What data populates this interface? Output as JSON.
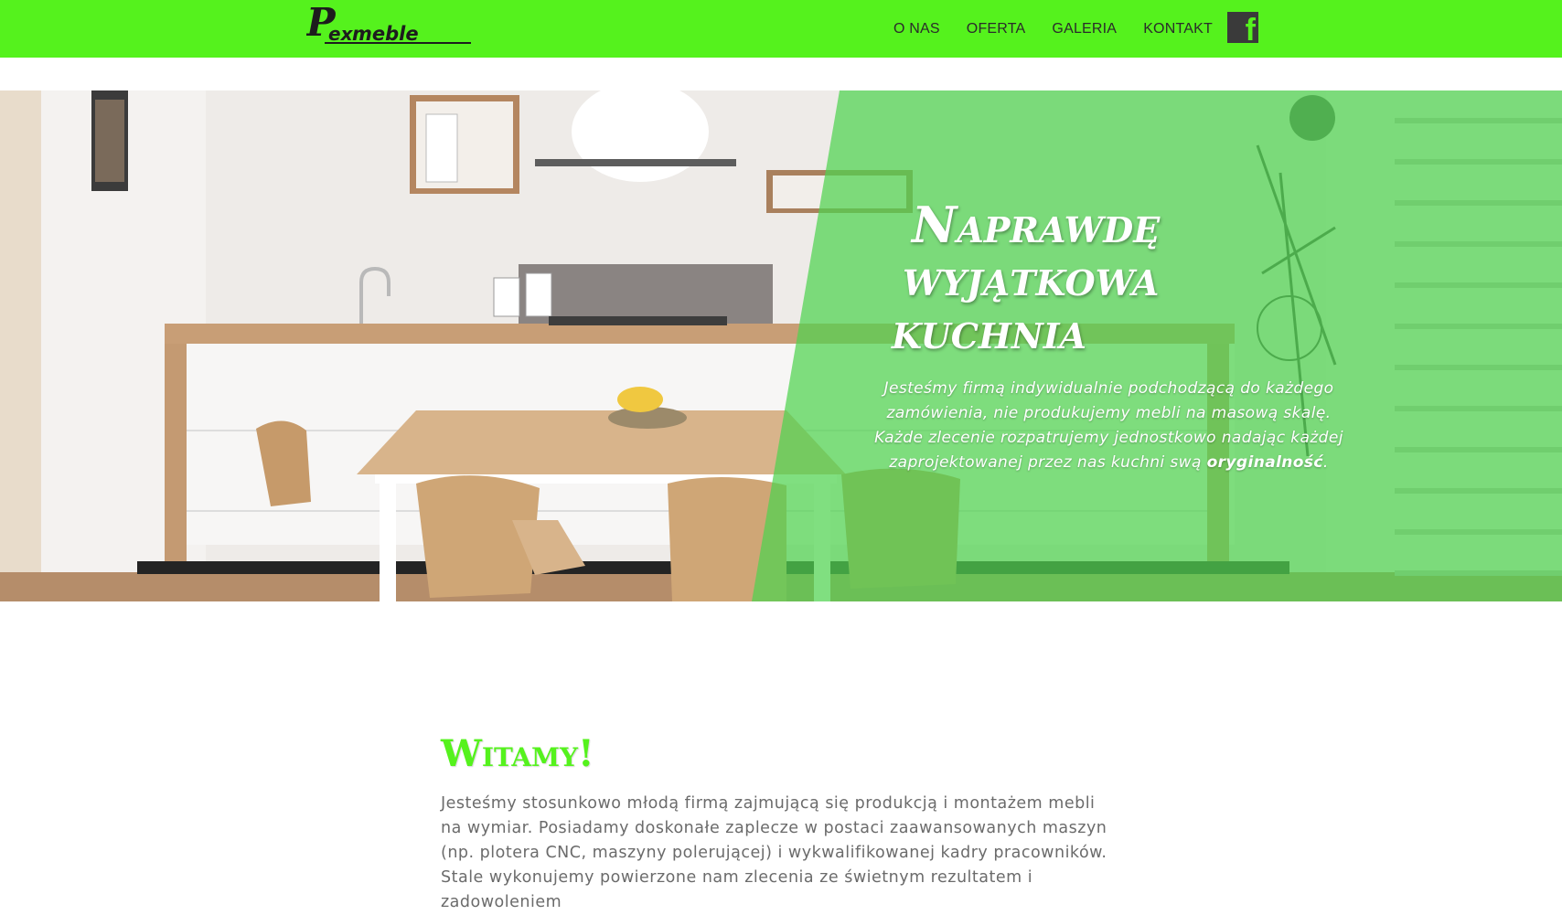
{
  "brand": {
    "logo_text": "Pexmeble",
    "accent": "#55f21d"
  },
  "nav": {
    "items": [
      "O NAS",
      "OFERTA",
      "GALERIA",
      "KONTAKT"
    ],
    "facebook_icon": "facebook-icon"
  },
  "hero": {
    "title_lines": [
      "Naprawdę",
      "wyjątkowa",
      "kuchnia"
    ],
    "text_before": "Jesteśmy firmą indywidualnie podchodzącą do każdego zamówienia, nie produkujemy mebli na masową skalę. Każde zlecenie rozpatrujemy jednostkowo nadając każdej zaprojektowanej przez nas kuchni swą ",
    "text_bold": "oryginalność",
    "text_after": ".",
    "overlay_color": "#4fd24f"
  },
  "welcome": {
    "title": "Witamy!",
    "text": "Jesteśmy stosunkowo młodą firmą zajmującą się produkcją i montażem mebli na wymiar. Posiadamy doskonałe zaplecze w postaci zaawansowanych maszyn (np. plotera CNC, maszyny polerującej) i wykwalifikowanej kadry pracowników. Stale wykonujemy powierzone nam zlecenia ze świetnym rezultatem i zadowoleniem"
  }
}
